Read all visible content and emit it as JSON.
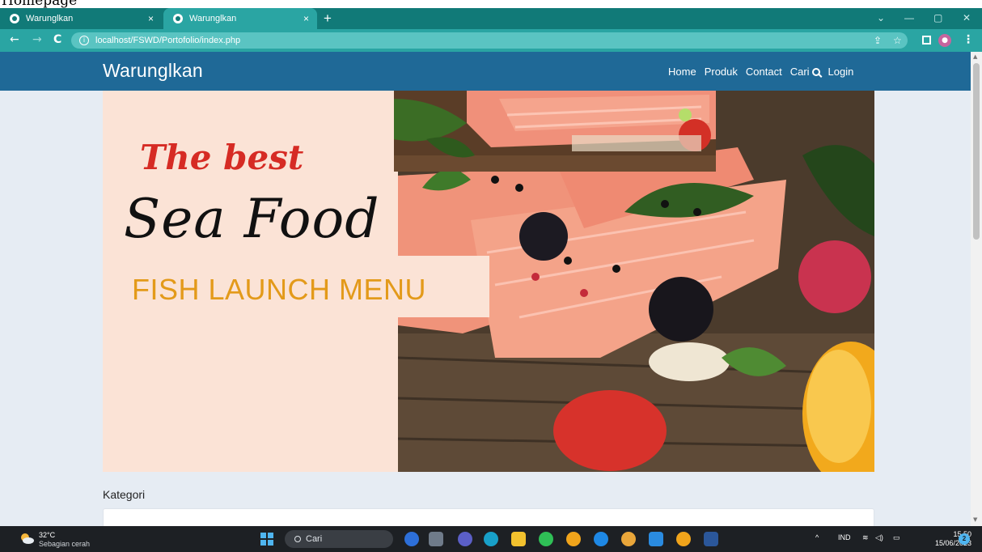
{
  "caption": {
    "text": "Homepage"
  },
  "browser": {
    "tabs": [
      {
        "title": "Warunglkan",
        "close": "×"
      },
      {
        "title": "Warunglkan",
        "close": "×"
      }
    ],
    "new_tab": "+",
    "window_controls": {
      "expand": "⌄",
      "minimize": "—",
      "restore": "▢",
      "close": "✕"
    },
    "nav": {
      "back": "←",
      "forward": "→",
      "reload": "C"
    },
    "url": "localhost/FSWD/Portofolio/index.php",
    "share": "⇪",
    "bookmark": "☆",
    "menu": "⋮"
  },
  "site": {
    "brand": "Warunglkan",
    "menu": {
      "home": "Home",
      "produk": "Produk",
      "contact": "Contact",
      "cari": "Cari",
      "login": "Login"
    },
    "banner": {
      "tagline": "The best",
      "headline": "Sea Food",
      "menu_title": "FISH LAUNCH MENU"
    },
    "kategori_label": "Kategori"
  },
  "taskbar": {
    "temperature": "32°C",
    "condition": "Sebagian cerah",
    "search_label": "Cari",
    "tray": {
      "chevron": "^",
      "lang": "IND",
      "wifi": "≋",
      "volume": "◁)",
      "battery": "▭"
    },
    "time": "15.50",
    "date": "15/06/2023",
    "notifications": "2"
  }
}
